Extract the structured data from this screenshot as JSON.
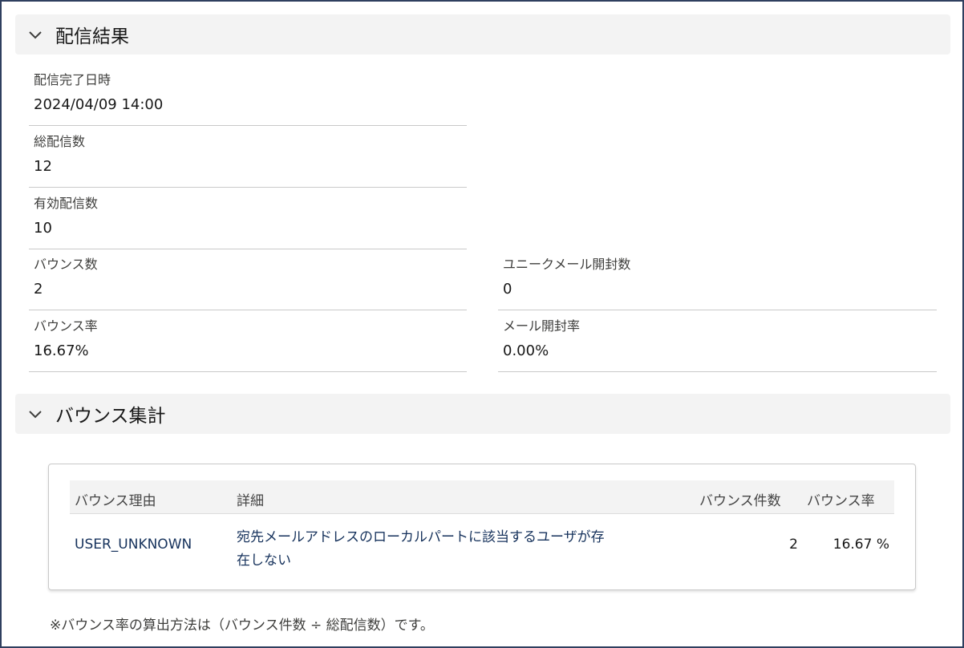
{
  "sections": {
    "results": {
      "title": "配信結果"
    },
    "bounce_summary": {
      "title": "バウンス集計"
    }
  },
  "fields": {
    "completed_at": {
      "label": "配信完了日時",
      "value": "2024/04/09 14:00"
    },
    "total_sent": {
      "label": "総配信数",
      "value": "12"
    },
    "valid_sent": {
      "label": "有効配信数",
      "value": "10"
    },
    "bounce_count": {
      "label": "バウンス数",
      "value": "2"
    },
    "bounce_rate": {
      "label": "バウンス率",
      "value": "16.67%"
    },
    "unique_opens": {
      "label": "ユニークメール開封数",
      "value": "0"
    },
    "open_rate": {
      "label": "メール開封率",
      "value": "0.00%"
    }
  },
  "table": {
    "headers": [
      "バウンス理由",
      "詳細",
      "バウンス件数",
      "バウンス率"
    ],
    "rows": [
      {
        "reason": "USER_UNKNOWN",
        "detail_line1": "宛先メールアドレスのローカルパートに該当するユーザが存",
        "detail_line2": "在しない",
        "count": "2",
        "rate": "16.67 %"
      }
    ]
  },
  "note": "※バウンス率の算出方法は（バウンス件数 ÷ 総配信数）です。",
  "colors": {
    "header_bg": "#f3f3f3",
    "link": "#16325c",
    "divider": "#c9c9c9",
    "frame": "#2f3f5f"
  },
  "icons": {
    "collapse": "chevron-down-icon"
  }
}
